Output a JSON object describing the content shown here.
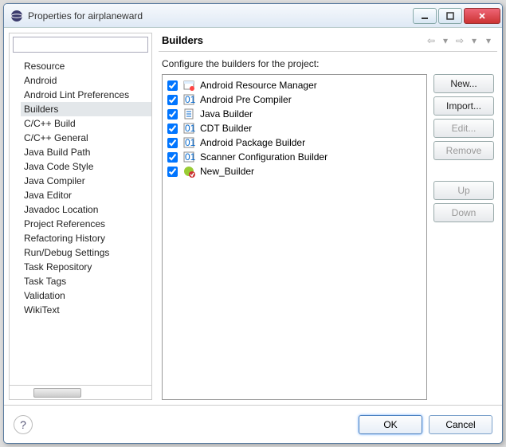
{
  "window": {
    "title": "Properties for airplaneward"
  },
  "tree": {
    "items": [
      "Resource",
      "Android",
      "Android Lint Preferences",
      "Builders",
      "C/C++ Build",
      "C/C++ General",
      "Java Build Path",
      "Java Code Style",
      "Java Compiler",
      "Java Editor",
      "Javadoc Location",
      "Project References",
      "Refactoring History",
      "Run/Debug Settings",
      "Task Repository",
      "Task Tags",
      "Validation",
      "WikiText"
    ],
    "selected": 3
  },
  "header": {
    "title": "Builders"
  },
  "description": "Configure the builders for the project:",
  "builders": [
    {
      "checked": true,
      "icon": "ant",
      "label": "Android Resource Manager"
    },
    {
      "checked": true,
      "icon": "bin",
      "label": "Android Pre Compiler"
    },
    {
      "checked": true,
      "icon": "doc",
      "label": "Java Builder"
    },
    {
      "checked": true,
      "icon": "bin",
      "label": "CDT Builder"
    },
    {
      "checked": true,
      "icon": "bin",
      "label": "Android Package Builder"
    },
    {
      "checked": true,
      "icon": "bin",
      "label": "Scanner Configuration Builder"
    },
    {
      "checked": true,
      "icon": "ext",
      "label": "New_Builder"
    }
  ],
  "buttons": {
    "new": "New...",
    "import": "Import...",
    "edit": "Edit...",
    "remove": "Remove",
    "up": "Up",
    "down": "Down"
  },
  "footer": {
    "ok": "OK",
    "cancel": "Cancel"
  },
  "filter_placeholder": ""
}
